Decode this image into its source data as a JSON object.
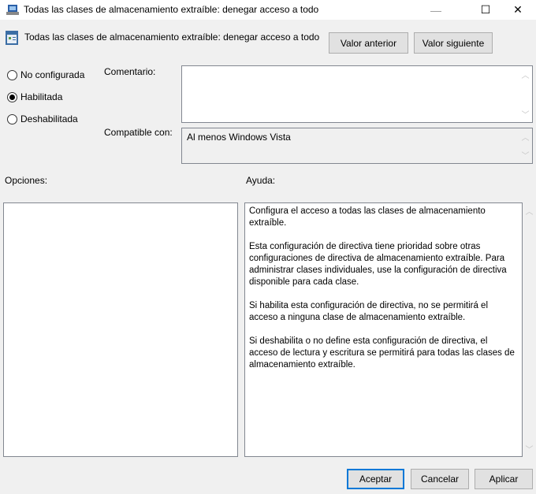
{
  "window": {
    "title": "Todas las clases de almacenamiento extraíble: denegar acceso a todo",
    "minimize": "—",
    "maximize": "☐",
    "close": "✕"
  },
  "header": {
    "title": "Todas las clases de almacenamiento extraíble: denegar acceso a todo",
    "prev_label": "Valor anterior",
    "next_label": "Valor siguiente"
  },
  "state": {
    "options": [
      {
        "label": "No configurada",
        "checked": false
      },
      {
        "label": "Habilitada",
        "checked": true
      },
      {
        "label": "Deshabilitada",
        "checked": false
      }
    ]
  },
  "comment": {
    "label": "Comentario:",
    "value": ""
  },
  "compatible": {
    "label": "Compatible con:",
    "value": "Al menos Windows Vista"
  },
  "options_label": "Opciones:",
  "help": {
    "label": "Ayuda:",
    "paragraphs": [
      "Configura el acceso a todas las clases de almacenamiento extraíble.",
      "Esta configuración de directiva tiene prioridad sobre otras configuraciones de directiva de almacenamiento extraíble. Para administrar clases individuales, use la configuración de directiva disponible para cada clase.",
      "Si habilita esta configuración de directiva, no se permitirá el acceso a ninguna clase de almacenamiento extraíble.",
      "Si deshabilita o no define esta configuración de directiva, el acceso de lectura y escritura se permitirá para todas las clases de almacenamiento extraíble."
    ]
  },
  "footer": {
    "ok": "Aceptar",
    "cancel": "Cancelar",
    "apply": "Aplicar"
  }
}
